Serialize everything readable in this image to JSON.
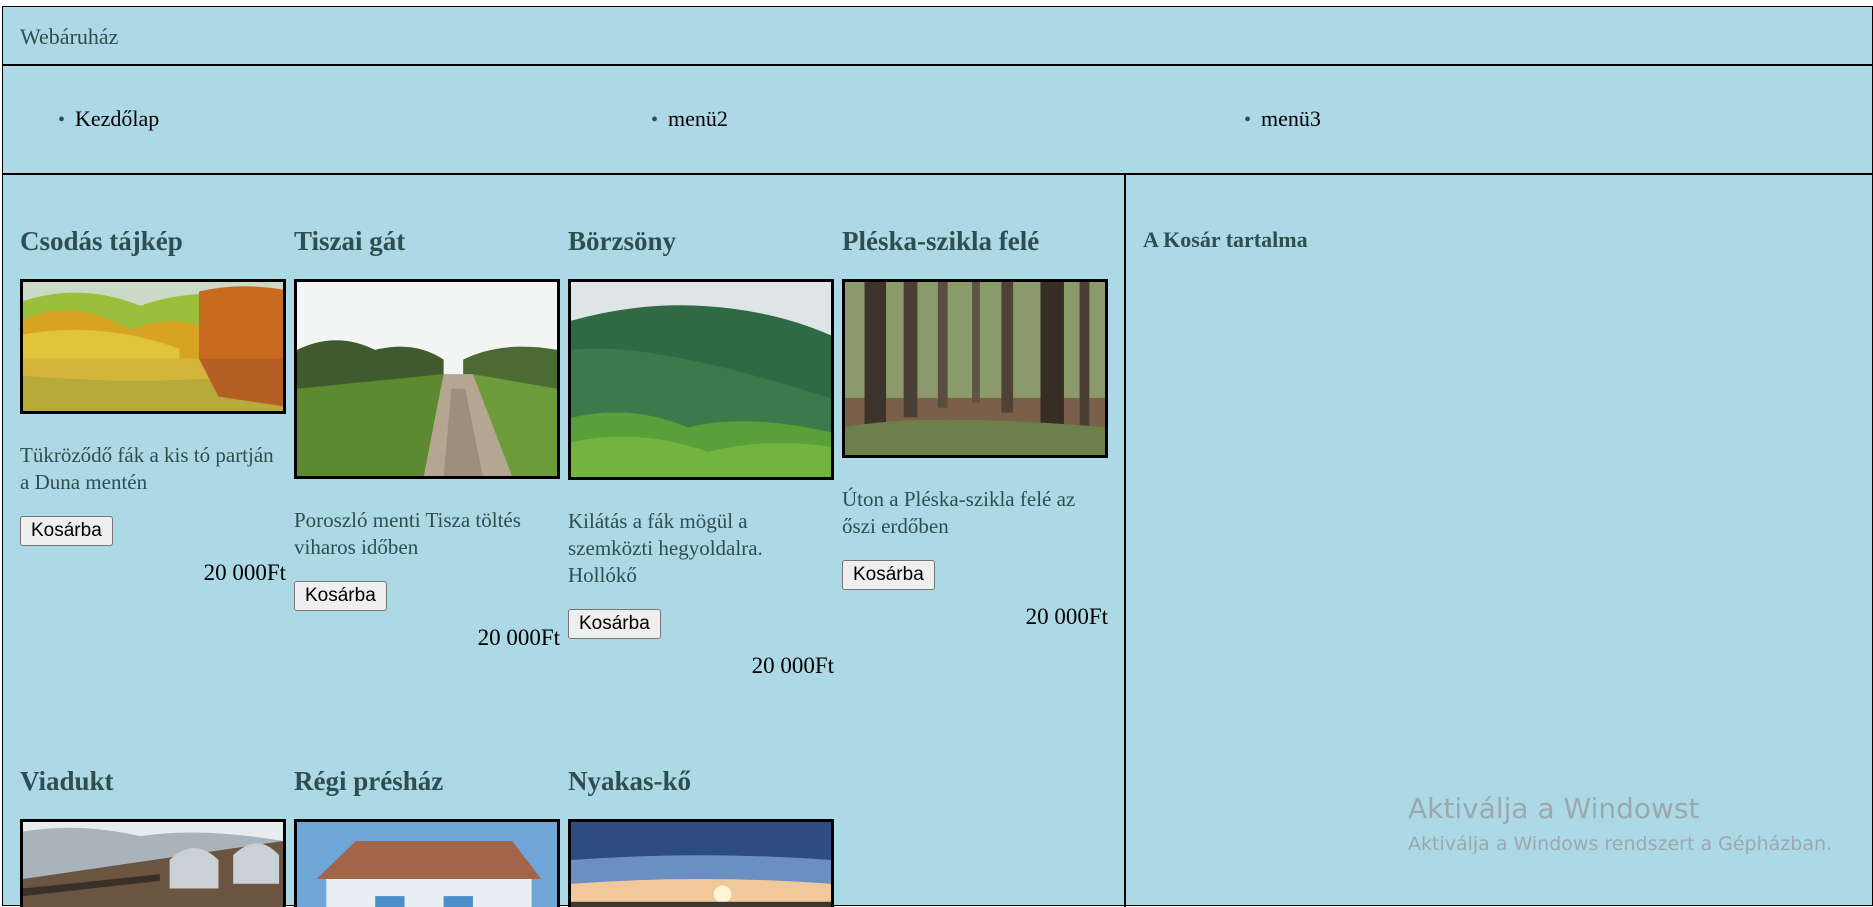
{
  "header": {
    "title": "Webáruház"
  },
  "nav": {
    "items": [
      {
        "label": "Kezdőlap"
      },
      {
        "label": "menü2"
      },
      {
        "label": "menü3"
      }
    ]
  },
  "products": [
    {
      "name": "Csodás tájkép",
      "description": "Tükröződő fák a kis tó partján a Duna mentén",
      "button": "Kosárba",
      "price": "20 000Ft"
    },
    {
      "name": "Tiszai gát",
      "description": "Poroszló menti Tisza töltés viharos időben",
      "button": "Kosárba",
      "price": "20 000Ft"
    },
    {
      "name": "Börzsöny",
      "description": "Kilátás a fák mögül a szemközti hegyoldalra. Hollókő",
      "button": "Kosárba",
      "price": "20 000Ft"
    },
    {
      "name": "Pléska-szikla felé",
      "description": "Úton a Pléska-szikla felé az őszi erdőben",
      "button": "Kosárba",
      "price": "20 000Ft"
    },
    {
      "name": "Viadukt"
    },
    {
      "name": "Régi présház"
    },
    {
      "name": "Nyakas-kő"
    }
  ],
  "cart": {
    "title": "A Kosár tartalma"
  },
  "watermark": {
    "line1": "Aktiválja a Windowst",
    "line2": "Aktiválja a Windows rendszert a Gépházban."
  },
  "colors": {
    "background": "#add8e6",
    "heading": "#2f4f4f"
  }
}
